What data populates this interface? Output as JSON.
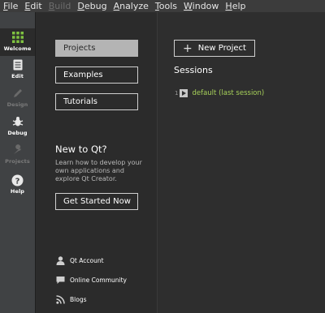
{
  "menubar": {
    "items": [
      {
        "label": "File",
        "mnemonic_index": 0,
        "enabled": true
      },
      {
        "label": "Edit",
        "mnemonic_index": 0,
        "enabled": true
      },
      {
        "label": "Build",
        "mnemonic_index": 0,
        "enabled": false
      },
      {
        "label": "Debug",
        "mnemonic_index": 0,
        "enabled": true
      },
      {
        "label": "Analyze",
        "mnemonic_index": 0,
        "enabled": true
      },
      {
        "label": "Tools",
        "mnemonic_index": 0,
        "enabled": true
      },
      {
        "label": "Window",
        "mnemonic_index": 0,
        "enabled": true
      },
      {
        "label": "Help",
        "mnemonic_index": 0,
        "enabled": true
      }
    ]
  },
  "modebar": {
    "modes": [
      {
        "label": "Welcome",
        "icon": "grid-icon",
        "active": true,
        "enabled": true
      },
      {
        "label": "Edit",
        "icon": "document-icon",
        "active": false,
        "enabled": true
      },
      {
        "label": "Design",
        "icon": "pencil-icon",
        "active": false,
        "enabled": false
      },
      {
        "label": "Debug",
        "icon": "bug-icon",
        "active": false,
        "enabled": true
      },
      {
        "label": "Projects",
        "icon": "wrench-icon",
        "active": false,
        "enabled": false
      },
      {
        "label": "Help",
        "icon": "help-icon",
        "active": false,
        "enabled": true
      }
    ]
  },
  "welcome": {
    "buttons": {
      "projects": "Projects",
      "examples": "Examples",
      "tutorials": "Tutorials"
    },
    "new_to_qt": {
      "heading": "New to Qt?",
      "blurb": "Learn how to develop your own applications and explore Qt Creator.",
      "cta": "Get Started Now"
    },
    "links": [
      {
        "label": "Qt Account",
        "icon": "user-icon"
      },
      {
        "label": "Online Community",
        "icon": "chat-icon"
      },
      {
        "label": "Blogs",
        "icon": "rss-icon"
      }
    ]
  },
  "right": {
    "new_project": "New Project",
    "sessions_heading": "Sessions",
    "sessions": [
      {
        "number": "1",
        "name": "default (last session)"
      }
    ]
  },
  "colors": {
    "background": "#2b2b2b",
    "modebar": "#404244",
    "session_link": "#a8d25a",
    "selected_button": "#b4b4b4"
  }
}
